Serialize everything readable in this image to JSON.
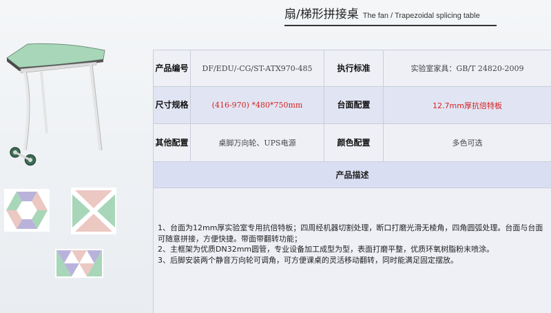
{
  "header": {
    "title_zh": "扇/梯形拼接桌",
    "title_en": "The fan / Trapezoidal  splicing table"
  },
  "specs": {
    "rows": [
      {
        "label1": "产品编号",
        "value1": "DF/EDU/-CG/ST-ATX970-485",
        "label2": "执行标准",
        "value2": "实验室家具：GB/T 24820-2009"
      },
      {
        "label1": "尺寸规格",
        "value1": "(416-970) *480*750mm",
        "label2": "台面配置",
        "value2": "12.7mm厚抗倍特板"
      },
      {
        "label1": "其他配置",
        "value1": "桌脚万向轮、UPS电源",
        "label2": "颜色配置",
        "value2": "多色可选"
      }
    ],
    "desc_header": "产品描述",
    "desc_lines": [
      "1、台面为12mm厚实验室专用抗倍特板；四周经机器切割处理，断口打磨光滑无棱角，四角圆弧处理。台面与台面可随意拼接，方便快捷。带面带翻转功能；",
      "2、主框架为优质DN32mm圆管，专业设备加工成型为型，表面打磨平整，优质环氧树脂粉末喷涂。",
      "3、后脚安装两个静音万向轮可调角，可方便课桌的灵活移动翻转，同时能满足固定摆放。"
    ]
  },
  "colors": {
    "green": "#a8d6b8",
    "lavender": "#b9b3dc",
    "pink": "#ecc8c2",
    "accent_red": "#d42020"
  }
}
